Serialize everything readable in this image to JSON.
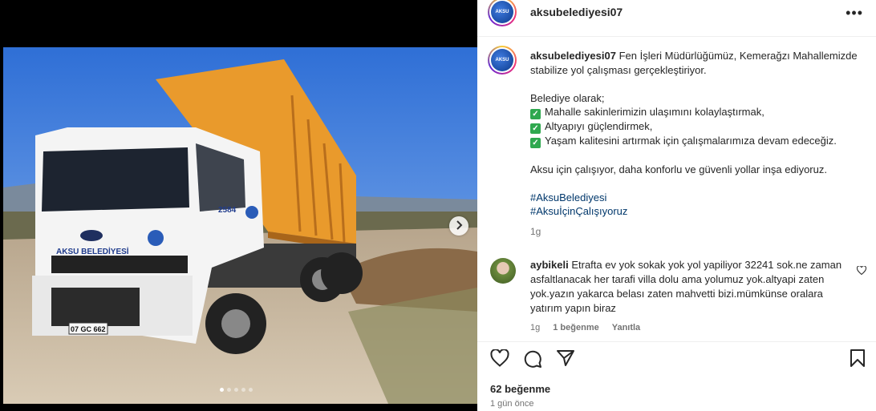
{
  "account": {
    "username": "aksubelediyesi07",
    "logo_text": "AKSU"
  },
  "caption": {
    "username": "aksubelediyesi07",
    "intro": "Fen İşleri Müdürlüğümüz, Kemerağzı Mahallemizde stabilize yol çalışması gerçekleştiriyor.",
    "subtitle": "Belediye olarak;",
    "items": [
      "Mahalle sakinlerimizin ulaşımını kolaylaştırmak,",
      "Altyapıyı güçlendirmek,",
      "Yaşam kalitesini artırmak için çalışmalarımıza devam edeceğiz."
    ],
    "closing": "Aksu için çalışıyor, daha konforlu ve güvenli yollar inşa ediyoruz.",
    "hashtags": [
      "#AksuBelediyesi",
      "#AksuİçinÇalışıyoruz"
    ],
    "age": "1g"
  },
  "comment": {
    "username": "aybikeli",
    "text": "Etrafta ev yok sokak yok yol yapiliyor 32241 sok.ne zaman asfaltlanacak her tarafi villa dolu ama yolumuz yok.altyapi zaten yok.yazın yakarca belası zaten mahvetti bizi.mümkünse oralara yatırım yapın biraz",
    "age": "1g",
    "likes": "1 beğenme",
    "reply": "Yanıtla"
  },
  "photo": {
    "truck_label": "AKSU BELEDİYESİ",
    "plate": "07 GC 662",
    "truck_number": "2584",
    "slide_count": 5,
    "active_slide": 1
  },
  "post": {
    "likes": "62 beğenme",
    "time": "1 gün önce"
  },
  "icons": {
    "more": "more-options-icon",
    "like": "heart-icon",
    "comment": "comment-icon",
    "share": "share-icon",
    "save": "bookmark-icon",
    "next": "chevron-right-icon"
  },
  "colors": {
    "link": "#00376b",
    "check": "#2fa84f",
    "sky": "#3f78d9"
  }
}
